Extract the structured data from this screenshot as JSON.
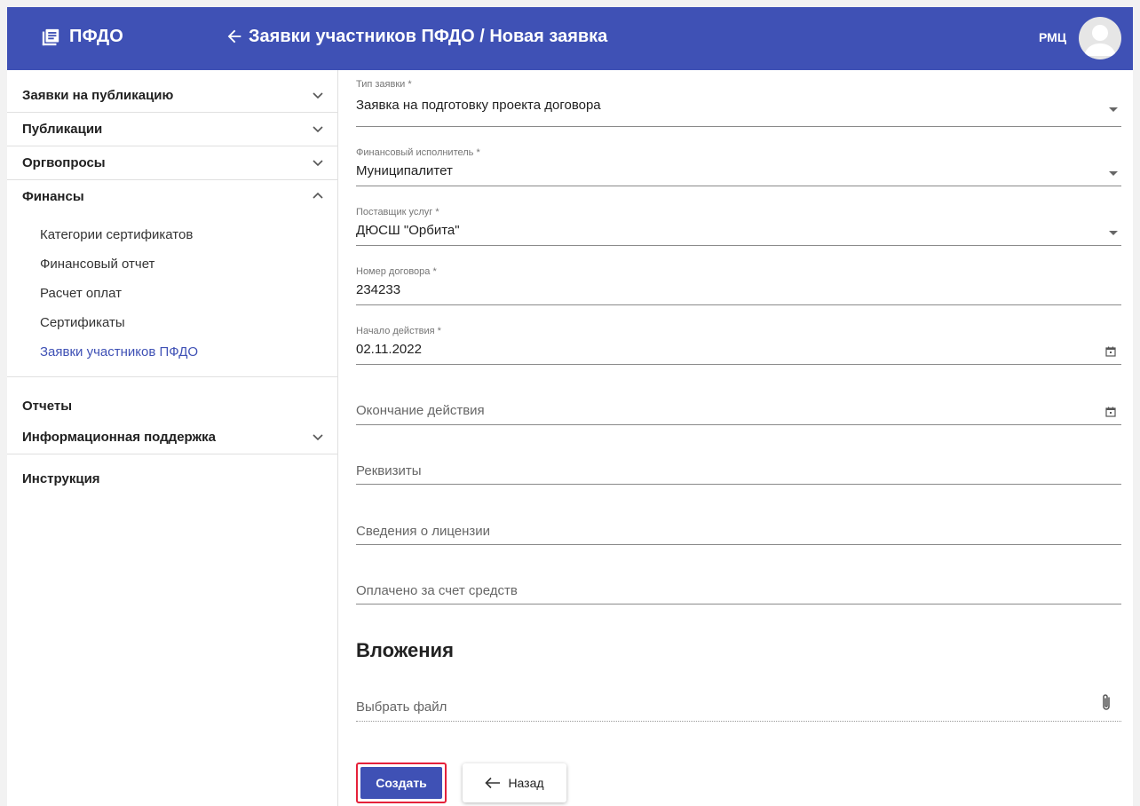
{
  "header": {
    "app_name": "ПФДО",
    "breadcrumb": "Заявки участников ПФДО / Новая заявка",
    "user": "РМЦ",
    "color": "#3f51b5"
  },
  "sidebar": {
    "items": [
      {
        "label": "Заявки на публикацию",
        "icon": "chevron-down-icon"
      },
      {
        "label": "Публикации",
        "icon": "chevron-down-icon"
      },
      {
        "label": "Оргвопросы",
        "icon": "chevron-down-icon"
      },
      {
        "label": "Финансы",
        "icon": "chevron-up-icon"
      }
    ],
    "finance_sub": [
      "Категории сертификатов",
      "Финансовый отчет",
      "Расчет оплат",
      "Сертификаты",
      "Заявки участников ПФДО"
    ],
    "reports": "Отчеты",
    "info_support": "Информационная поддержка",
    "instructions": "Инструкция"
  },
  "form": {
    "request_type": {
      "label": "Тип заявки *",
      "value": "Заявка на подготовку проекта договора"
    },
    "fin_executor": {
      "label": "Финансовый исполнитель *",
      "value": "Муниципалитет"
    },
    "provider": {
      "label": "Поставщик услуг *",
      "value": "ДЮСШ \"Орбита\""
    },
    "contract_number": {
      "label": "Номер договора *",
      "value": "234233"
    },
    "start_date": {
      "label": "Начало действия *",
      "value": "02.11.2022"
    },
    "end_date": {
      "placeholder": "Окончание действия"
    },
    "requisites": {
      "placeholder": "Реквизиты"
    },
    "license": {
      "placeholder": "Сведения о лицензии"
    },
    "paid_by": {
      "placeholder": "Оплачено за счет средств"
    },
    "attachments_title": "Вложения",
    "file_placeholder": "Выбрать файл"
  },
  "buttons": {
    "create": "Создать",
    "back": "Назад"
  }
}
